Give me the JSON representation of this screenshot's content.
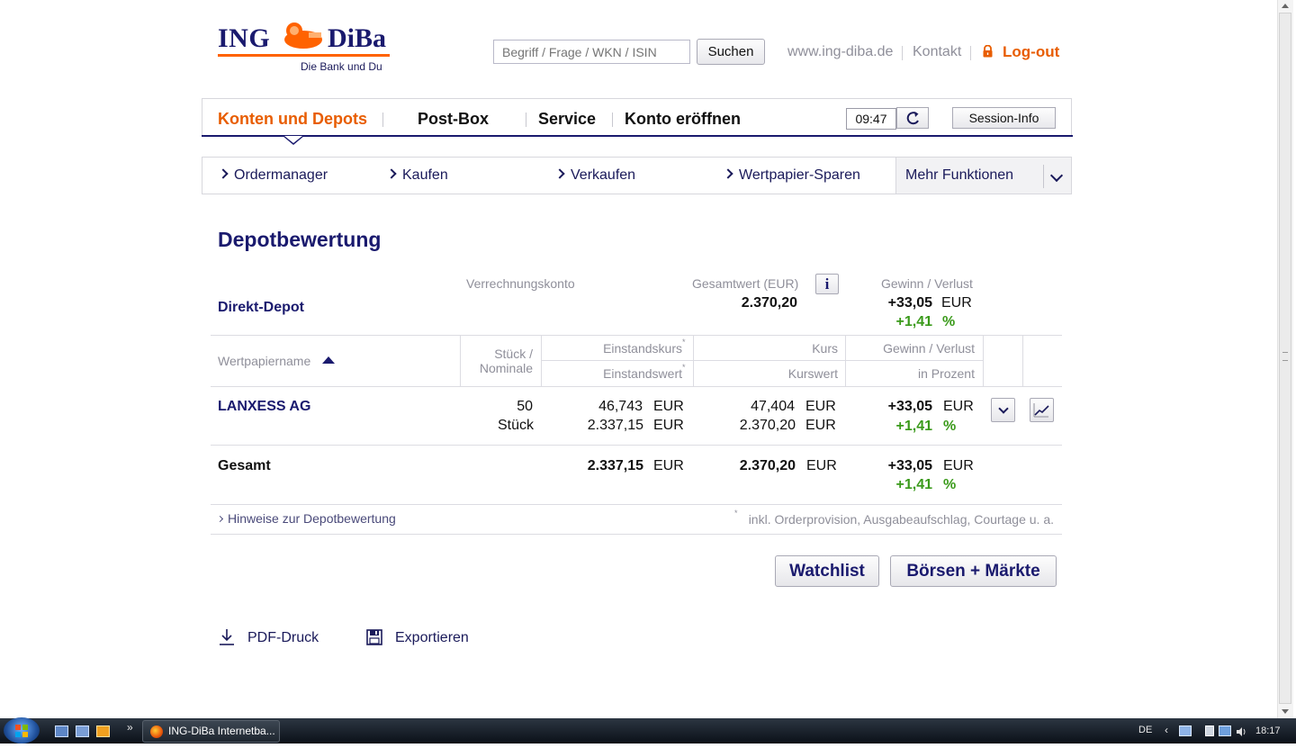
{
  "header": {
    "logo": {
      "left": "ING",
      "right": "DiBa",
      "tagline": "Die Bank und Du"
    },
    "search": {
      "placeholder": "Begriff / Frage / WKN / ISIN",
      "button": "Suchen"
    },
    "links": [
      "www.ing-diba.de",
      "Kontakt"
    ],
    "logout": "Log-out"
  },
  "mainnav": {
    "items": [
      "Konten und Depots",
      "Post-Box",
      "Service",
      "Konto eröffnen"
    ],
    "timer": "09:47",
    "session": "Session-Info"
  },
  "subnav": {
    "items": [
      "Ordermanager",
      "Kaufen",
      "Verkaufen",
      "Wertpapier-Sparen"
    ],
    "more": "Mehr Funktionen"
  },
  "content": {
    "title": "Depotbewertung",
    "summary": {
      "account_col": "Verrechnungskonto",
      "total_label": "Gesamtwert (EUR)",
      "gl_label": "Gewinn / Verlust",
      "depot_name": "Direkt-Depot",
      "total_value": "2.370,20",
      "gl_abs": "+33,05",
      "gl_abs_unit": "EUR",
      "gl_pct": "+1,41",
      "gl_pct_unit": "%"
    },
    "table": {
      "col_name": "Wertpapiername",
      "col_qty_1": "Stück /",
      "col_qty_2": "Nominale",
      "col_cost_1": "Einstandskurs",
      "col_cost_2": "Einstandswert",
      "col_price_1": "Kurs",
      "col_price_2": "Kurswert",
      "col_gl_1": "Gewinn / Verlust",
      "col_gl_2": "in Prozent",
      "footnote_mark": "*",
      "row": {
        "name": "LANXESS AG",
        "qty": "50",
        "qty_unit": "Stück",
        "cost_price": "46,743",
        "cost_value": "2.337,15",
        "price": "47,404",
        "value": "2.370,20",
        "gl_abs": "+33,05",
        "gl_pct": "+1,41"
      },
      "total": {
        "label": "Gesamt",
        "cost_value": "2.337,15",
        "value": "2.370,20",
        "gl_abs": "+33,05",
        "gl_pct": "+1,41"
      },
      "unit_eur": "EUR",
      "unit_pct": "%",
      "hint_link": "Hinweise zur Depotbewertung",
      "footnote": "inkl. Orderprovision, Ausgabeaufschlag, Courtage u. a."
    },
    "buttons": {
      "watchlist": "Watchlist",
      "markets": "Börsen + Märkte"
    },
    "actions": {
      "pdf": "PDF-Druck",
      "export": "Exportieren"
    }
  },
  "taskbar": {
    "window": "ING-DiBa Internetba...",
    "lang": "DE",
    "clock": "18:17"
  },
  "colors": {
    "accent": "#e85d00",
    "navy": "#1a1a6e",
    "positive": "#3a9a1a"
  }
}
